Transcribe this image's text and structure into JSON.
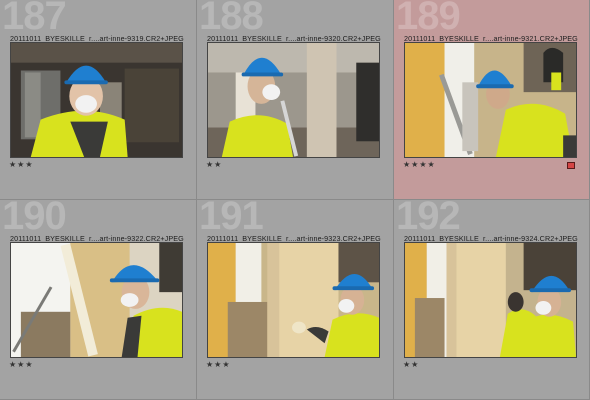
{
  "cells": [
    {
      "index": "187",
      "filename": "20111011_BYESKILLE_r....art-inne-9319.CR2+JPEG",
      "rating": "★★★",
      "selected": false,
      "flagged": false
    },
    {
      "index": "188",
      "filename": "20111011_BYESKILLE_r....art-inne-9320.CR2+JPEG",
      "rating": "★★",
      "selected": false,
      "flagged": false
    },
    {
      "index": "189",
      "filename": "20111011_BYESKILLE_r....art-inne-9321.CR2+JPEG",
      "rating": "★★★★",
      "selected": true,
      "flagged": true
    },
    {
      "index": "190",
      "filename": "20111011_BYESKILLE_r....art-inne-9322.CR2+JPEG",
      "rating": "★★★",
      "selected": false,
      "flagged": false
    },
    {
      "index": "191",
      "filename": "20111011_BYESKILLE_r....art-inne-9323.CR2+JPEG",
      "rating": "★★★",
      "selected": false,
      "flagged": false
    },
    {
      "index": "192",
      "filename": "20111011_BYESKILLE_r....art-inne-9324.CR2+JPEG",
      "rating": "★★",
      "selected": false,
      "flagged": false
    }
  ],
  "colors": {
    "cell_bg": "#a3a3a3",
    "selected_bg": "#c39b9b",
    "hard_hat": "#1f7fd0",
    "hi_vis_vest": "#d8e21e",
    "flag_red": "#d44545"
  }
}
